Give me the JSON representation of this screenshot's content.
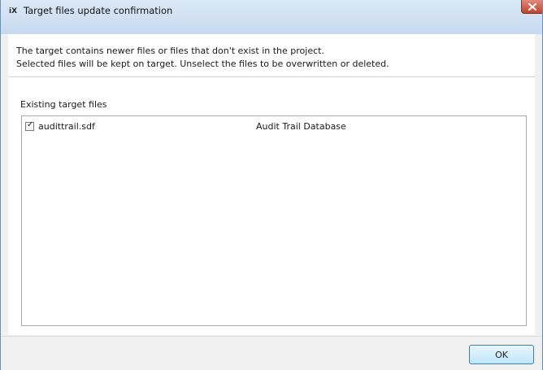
{
  "window": {
    "title": "Target files update confirmation",
    "app_icon_text": "iX"
  },
  "message": {
    "line1": "The target contains newer files or files that don't exist in the project.",
    "line2": "Selected files will be kept on target. Unselect the files to be overwritten or deleted."
  },
  "existing_files": {
    "label": "Existing target files",
    "items": [
      {
        "checked": true,
        "name": "audittrail.sdf",
        "description": "Audit Trail Database"
      }
    ]
  },
  "buttons": {
    "ok_label": "OK"
  },
  "colors": {
    "titlebar": "#c7daf0",
    "close_button": "#c0442d",
    "ok_border": "#3c7fb1"
  },
  "icons": {
    "app": "ix-app-icon",
    "close": "close-icon",
    "check": "checkmark-icon"
  }
}
